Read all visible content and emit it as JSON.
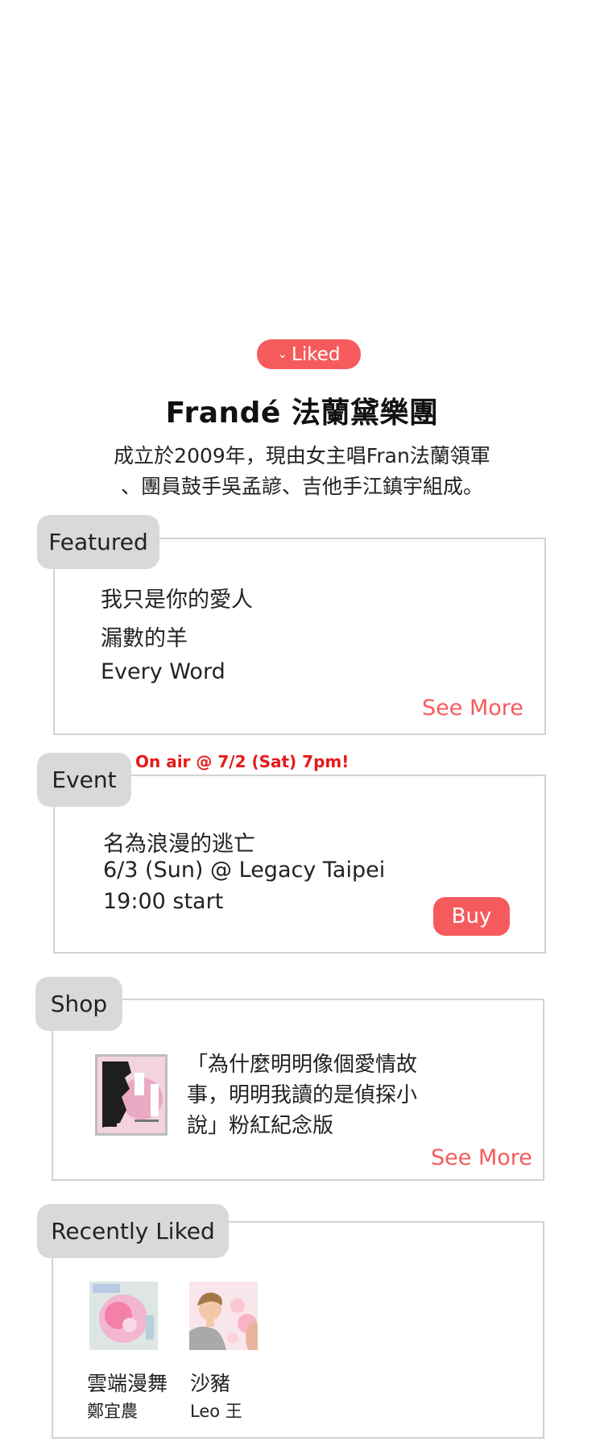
{
  "liked_badge": {
    "label": "Liked"
  },
  "artist": {
    "name": "Frandé 法蘭黛樂團",
    "description_line1": "成立於2009年，現由女主唱Fran法蘭領軍",
    "description_line2": "、團員鼓手吳孟諺、吉他手江鎮宇組成。"
  },
  "featured": {
    "tab_label": "Featured",
    "songs": [
      "我只是你的愛人",
      "漏數的羊",
      "Every Word"
    ],
    "see_more": "See More"
  },
  "event": {
    "tab_label": "Event",
    "on_air": "On air @ 7/2 (Sat) 7pm!",
    "title": "名為浪漫的逃亡",
    "date_venue": "6/3 (Sun) @ Legacy Taipei",
    "start_time": "19:00 start",
    "buy_label": "Buy"
  },
  "shop": {
    "tab_label": "Shop",
    "item_line1": "「為什麼明明像個愛情故",
    "item_line2": "事，明明我讀的是偵探小",
    "item_line3": "說」粉紅紀念版",
    "see_more": "See More"
  },
  "recently_liked": {
    "tab_label": "Recently Liked",
    "items": [
      {
        "title": "雲端漫舞",
        "artist": "鄭宜農"
      },
      {
        "title": "沙豬",
        "artist": "Leo 王"
      }
    ]
  },
  "colors": {
    "accent": "#f55b5d",
    "on_air": "#e61a1a",
    "tab_bg": "#d9d9d9",
    "border": "#d2d2d2"
  }
}
